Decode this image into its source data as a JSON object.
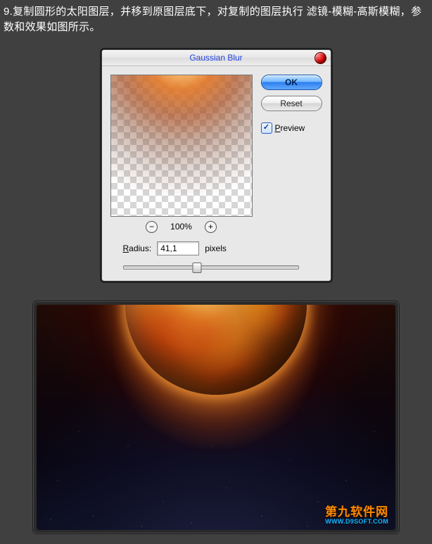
{
  "instruction": "9.复制圆形的太阳图层，并移到原图层底下，对复制的图层执行 滤镜-模糊-高斯模糊，参数和效果如图所示。",
  "dialog": {
    "title": "Gaussian Blur",
    "ok_label": "OK",
    "reset_label": "Reset",
    "preview_label": "review",
    "preview_mnemonic": "P",
    "preview_checked": true,
    "zoom_pct": "100%",
    "zoom_out_glyph": "−",
    "zoom_in_glyph": "+",
    "radius_label_mnemonic": "R",
    "radius_label_rest": "adius:",
    "radius_value": "41,1",
    "radius_unit": "pixels"
  },
  "result": {
    "watermark_main": "第九软件网",
    "watermark_sub": "WWW.D9SOFT.COM"
  }
}
